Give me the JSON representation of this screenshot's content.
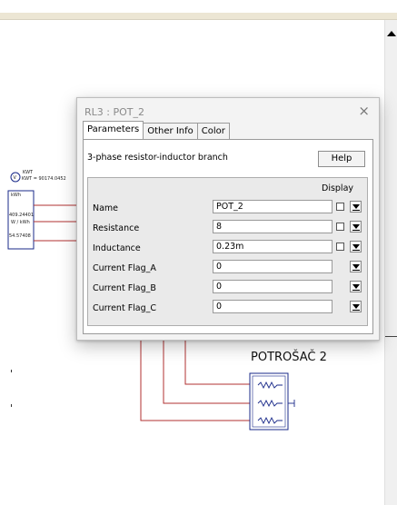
{
  "dialog": {
    "title": "RL3 : POT_2",
    "close_glyph": "×",
    "tabs": [
      {
        "label": "Parameters",
        "active": true
      },
      {
        "label": "Other Info",
        "active": false
      },
      {
        "label": "Color",
        "active": false
      }
    ],
    "description": "3-phase resistor-inductor branch",
    "help_label": "Help",
    "display_header": "Display",
    "rows": [
      {
        "label": "Name",
        "value": "POT_2",
        "has_checkbox": true
      },
      {
        "label": "Resistance",
        "value": "8",
        "has_checkbox": true
      },
      {
        "label": "Inductance",
        "value": "0.23m",
        "has_checkbox": true
      },
      {
        "label": "Current Flag_A",
        "value": "0",
        "has_checkbox": false
      },
      {
        "label": "Current Flag_B",
        "value": "0",
        "has_checkbox": false
      },
      {
        "label": "Current Flag_C",
        "value": "0",
        "has_checkbox": false
      }
    ]
  },
  "schematic": {
    "component_label": "POTROŠAČ 2",
    "meter": {
      "symbol": "V",
      "name": "KWT",
      "value_text": "KWT = 90174.0452",
      "top_label": "kWh",
      "readings": [
        "409.24401",
        "W / kWh",
        "54.57408"
      ]
    },
    "wire_color": "#b03030"
  }
}
